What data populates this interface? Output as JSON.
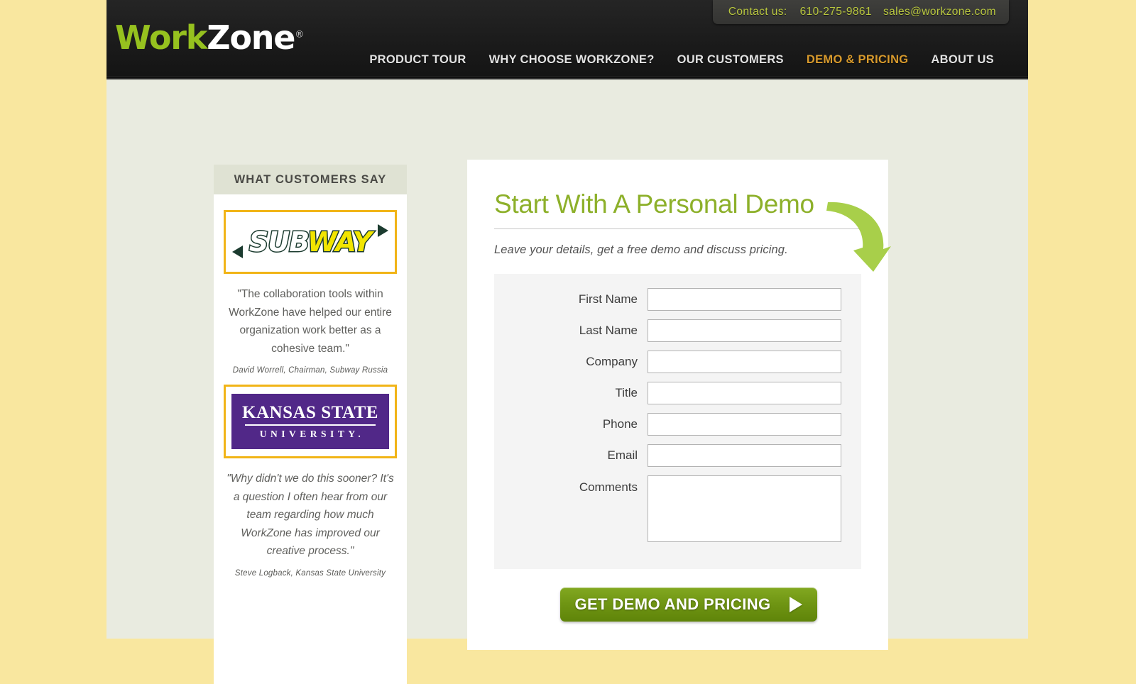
{
  "theme": {
    "outer_background": "#f9e79f",
    "page_background": "#e9ebe0",
    "header_background": "#1e1e1e",
    "brand_green": "#96c11f",
    "heading_green": "#8db02a",
    "accent_gold": "#d89a2c",
    "contact_text_green": "#b9c73f",
    "logo_frame_gold": "#f1b417",
    "ksu_purple": "#512888",
    "button_green": "#6d9312"
  },
  "header": {
    "contact": {
      "label": "Contact us:",
      "phone": "610-275-9861",
      "email": "sales@workzone.com"
    },
    "logo": {
      "part_one": "Work",
      "part_two": "Zone",
      "trademark": "®"
    },
    "nav": [
      {
        "label": "PRODUCT TOUR",
        "active": false
      },
      {
        "label": "WHY CHOOSE WORKZONE?",
        "active": false
      },
      {
        "label": "OUR CUSTOMERS",
        "active": false
      },
      {
        "label": "DEMO & PRICING",
        "active": true
      },
      {
        "label": "ABOUT US",
        "active": false
      }
    ]
  },
  "sidebar": {
    "title": "WHAT CUSTOMERS SAY",
    "testimonials": [
      {
        "logo_name": "subway-logo",
        "logo_text_primary": "SUB",
        "logo_text_secondary": "WAY",
        "quote": "\"The collaboration tools within WorkZone have helped our entire organization work better\nas a cohesive team.\"",
        "attribution": "David Worrell, Chairman, Subway Russia"
      },
      {
        "logo_name": "kansas-state-university-logo",
        "logo_text_primary": "KANSAS STATE",
        "logo_text_secondary": "UNIVERSITY.",
        "quote": "\"Why didn't we do this sooner? It's a question I often hear from our team regarding how much WorkZone has improved our creative process.\"",
        "attribution": "Steve Logback, Kansas State University"
      }
    ]
  },
  "demo": {
    "heading": "Start With A Personal Demo",
    "subheading": "Leave your details, get a free demo and discuss pricing.",
    "fields": [
      {
        "label": "First Name",
        "value": "",
        "placeholder": "",
        "type": "text",
        "name": "first-name"
      },
      {
        "label": "Last Name",
        "value": "",
        "placeholder": "",
        "type": "text",
        "name": "last-name"
      },
      {
        "label": "Company",
        "value": "",
        "placeholder": "",
        "type": "text",
        "name": "company"
      },
      {
        "label": "Title",
        "value": "",
        "placeholder": "",
        "type": "text",
        "name": "title"
      },
      {
        "label": "Phone",
        "value": "",
        "placeholder": "",
        "type": "text",
        "name": "phone"
      },
      {
        "label": "Email",
        "value": "",
        "placeholder": "",
        "type": "text",
        "name": "email"
      }
    ],
    "comments": {
      "label": "Comments",
      "value": "",
      "placeholder": ""
    },
    "submit_label": "GET DEMO AND PRICING",
    "submit_arrow": "play-triangle-icon"
  }
}
